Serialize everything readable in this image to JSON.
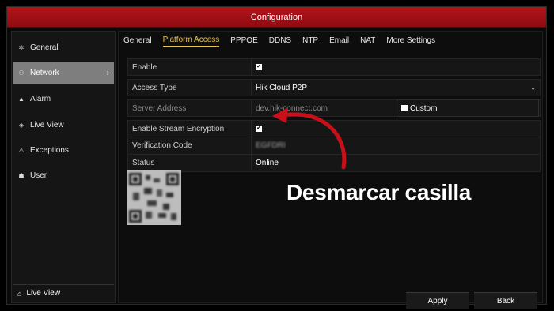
{
  "window": {
    "title": "Configuration"
  },
  "sidebar": {
    "items": [
      {
        "label": "General",
        "icon": "gear-icon"
      },
      {
        "label": "Network",
        "icon": "network-icon",
        "active": true
      },
      {
        "label": "Alarm",
        "icon": "bell-icon"
      },
      {
        "label": "Live View",
        "icon": "eye-icon"
      },
      {
        "label": "Exceptions",
        "icon": "warning-icon"
      },
      {
        "label": "User",
        "icon": "users-icon"
      }
    ],
    "bottom": {
      "label": "Live View",
      "icon": "home-icon"
    }
  },
  "tabs": [
    {
      "label": "General"
    },
    {
      "label": "Platform Access",
      "active": true
    },
    {
      "label": "PPPOE"
    },
    {
      "label": "DDNS"
    },
    {
      "label": "NTP"
    },
    {
      "label": "Email"
    },
    {
      "label": "NAT"
    },
    {
      "label": "More Settings"
    }
  ],
  "form": {
    "enable": {
      "label": "Enable",
      "checked": true
    },
    "access_type": {
      "label": "Access Type",
      "value": "Hik Cloud P2P"
    },
    "server_address": {
      "label": "Server Address",
      "value": "dev.hik-connect.com",
      "custom_label": "Custom",
      "custom_checked": false
    },
    "stream_encryption": {
      "label": "Enable Stream Encryption",
      "checked": true
    },
    "verification_code": {
      "label": "Verification Code",
      "value": "EGFDRI"
    },
    "status": {
      "label": "Status",
      "value": "Online"
    }
  },
  "buttons": {
    "apply": "Apply",
    "back": "Back"
  },
  "annotation": {
    "text": "Desmarcar casilla",
    "color": "#c8101a"
  },
  "colors": {
    "titlebar": "#a50f16",
    "active_tab": "#e8c14a",
    "sidebar_active": "#7e7e7e"
  }
}
